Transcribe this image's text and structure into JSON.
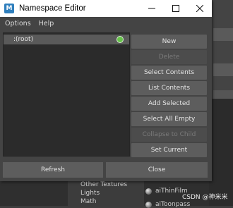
{
  "window": {
    "title": "Namespace Editor",
    "app_icon_letter": "M",
    "controls": {
      "minimize": "—",
      "maximize": "☐",
      "close": "✕"
    }
  },
  "menu": [
    "Options",
    "Help"
  ],
  "namespace_list": {
    "items": [
      {
        "label": ":(root)",
        "status_color": "#66c24a",
        "selected": true
      }
    ]
  },
  "buttons": [
    {
      "label": "New",
      "enabled": true
    },
    {
      "label": "Delete",
      "enabled": false
    },
    {
      "label": "Select Contents",
      "enabled": true
    },
    {
      "label": "List Contents",
      "enabled": true
    },
    {
      "label": "Add Selected",
      "enabled": true
    },
    {
      "label": "Select All Empty",
      "enabled": true
    },
    {
      "label": "Collapse to Child",
      "enabled": false
    },
    {
      "label": "Set Current",
      "enabled": true
    }
  ],
  "footer": {
    "refresh_label": "Refresh",
    "close_label": "Close"
  },
  "background": {
    "list_items": [
      "Other Textures",
      "Lights",
      "Math"
    ],
    "nodes": [
      "aiThinFilm",
      "aiToonpass"
    ],
    "watermark": "CSDN @神米米"
  }
}
